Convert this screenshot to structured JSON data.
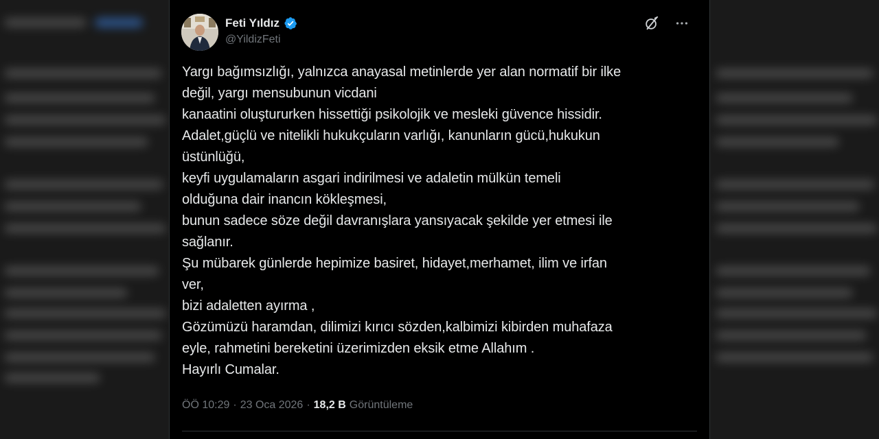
{
  "author": {
    "display_name": "Feti Yıldız",
    "handle": "@YildizFeti",
    "verified": true
  },
  "icons": {
    "verified": "verified-badge-icon",
    "grok": "grok-icon",
    "more": "more-icon"
  },
  "colors": {
    "verified_blue": "#1d9bf0",
    "text_primary": "#e7e9ea",
    "text_secondary": "#71767b",
    "background": "#000000"
  },
  "tweet": {
    "lines": [
      "Yargı bağımsızlığı, yalnızca anayasal metinlerde yer alan normatif bir ilke",
      "değil, yargı mensubunun vicdani",
      "kanaatini oluştururken hissettiği psikolojik ve mesleki güvence hissidir.",
      "Adalet,güçlü ve nitelikli hukukçuların varlığı, kanunların gücü,hukukun",
      "üstünlüğü,",
      "keyfi uygulamaların asgari indirilmesi ve adaletin mülkün temeli",
      "olduğuna dair inancın  kökleşmesi,",
      "bunun sadece söze değil davranışlara yansıyacak şekilde yer etmesi ile",
      "sağlanır.",
      "Şu mübarek günlerde hepimize basiret, hidayet,merhamet, ilim ve irfan",
      "ver,",
      "bizi adaletten ayırma ,",
      "Gözümüzü haramdan, dilimizi kırıcı sözden,kalbimizi kibirden muhafaza",
      "eyle, rahmetini bereketini üzerimizden eksik etme Allahım .",
      "Hayırlı Cumalar."
    ]
  },
  "meta": {
    "time": "ÖÖ 10:29",
    "separator": "·",
    "date": "23 Oca 2026",
    "views_count": "18,2 B",
    "views_label": "Görüntüleme"
  }
}
